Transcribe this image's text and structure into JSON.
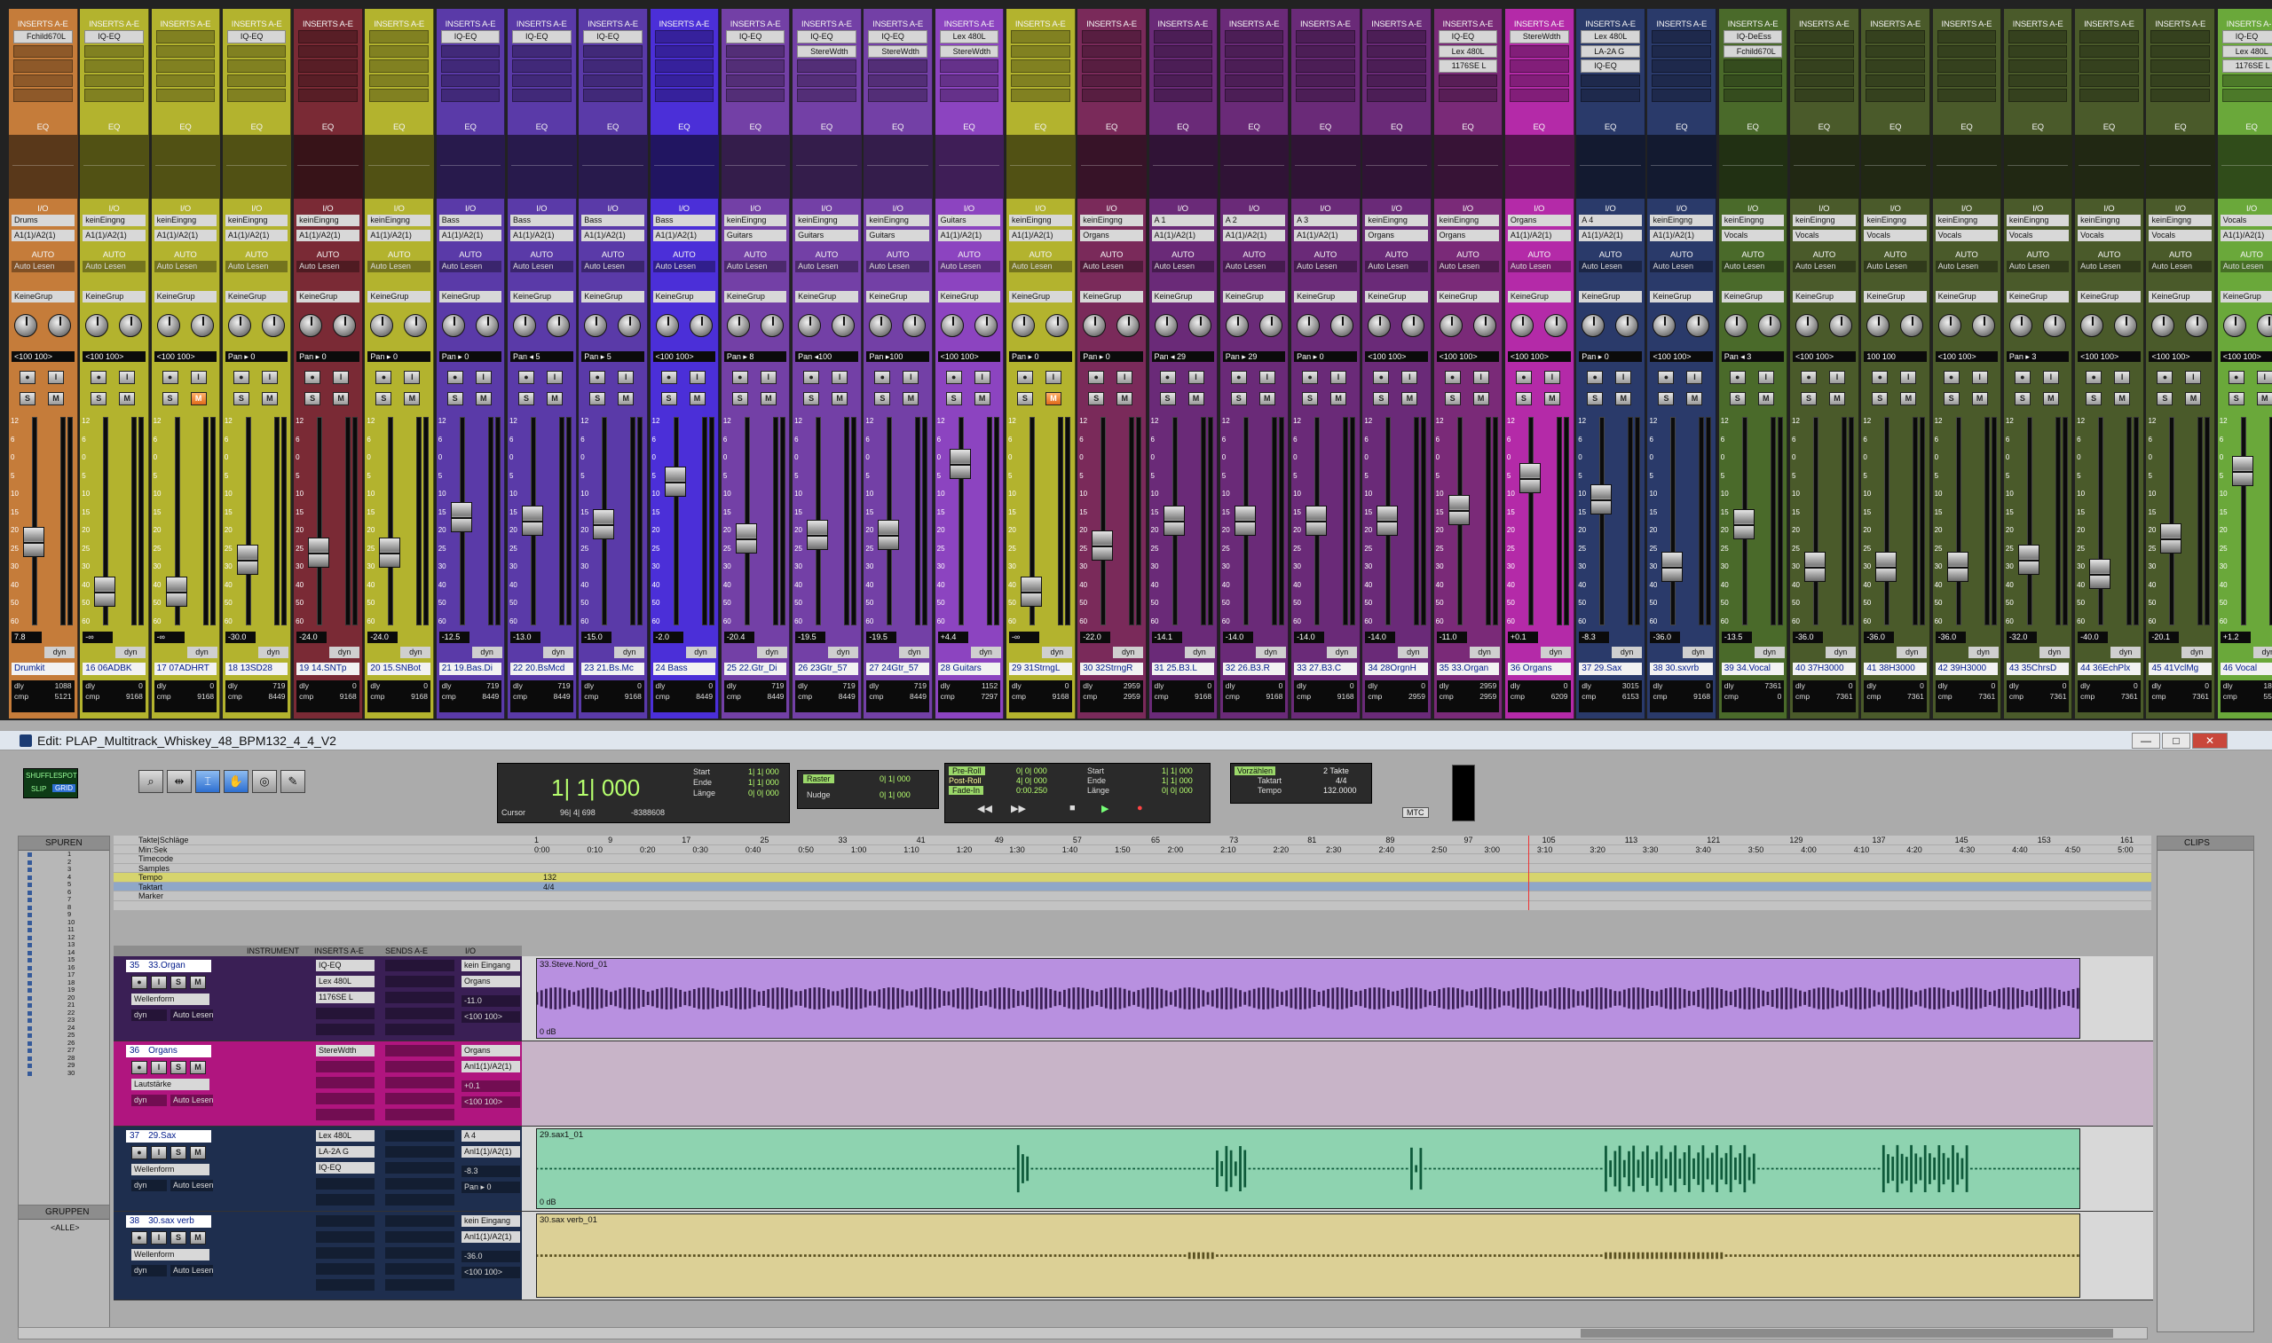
{
  "insert_header": "INSERTS A-E",
  "eq_label": "EQ",
  "io_label": "I/O",
  "auto_label": "AUTO",
  "auto_value": "Auto Lesen",
  "group_value": "KeineGrup",
  "pan_label": "Pan",
  "dyn_label": "dyn",
  "dly_label": "dly",
  "cmp_label": "cmp",
  "meter_scale": [
    "12",
    "6",
    "0",
    "5",
    "10",
    "15",
    "20",
    "25",
    "30",
    "40",
    "50",
    "60"
  ],
  "colors": {
    "accent_blue": "#2d6fd1",
    "edit_bg": "#ababab"
  },
  "mixer": {
    "tracks": [
      {
        "name": "Drumkit",
        "color": "#c57c3a",
        "inserts": [
          "Fchild670L"
        ],
        "io_in": "Drums",
        "io_out": "A1(1)/A2(1)",
        "vol": "7.8",
        "pan": "<100 100>",
        "dly": "1088",
        "cmp": "5121",
        "fader": 0.62
      },
      {
        "name": "16 06ADBK",
        "color": "#b3b32e",
        "inserts": [
          "IQ-EQ"
        ],
        "io_in": "keinEingng",
        "io_out": "A1(1)/A2(1)",
        "vol": "-∞",
        "pan": "<100 100>",
        "dly": "0",
        "cmp": "9168",
        "fader": 0.9
      },
      {
        "name": "17 07ADHRT",
        "color": "#b3b32e",
        "inserts": [],
        "io_in": "keinEingng",
        "io_out": "A1(1)/A2(1)",
        "vol": "-∞",
        "pan": "<100 100>",
        "dly": "0",
        "cmp": "9168",
        "fader": 0.9
      },
      {
        "name": "18 13SD28",
        "color": "#b3b32e",
        "inserts": [
          "IQ-EQ"
        ],
        "io_in": "keinEingng",
        "io_out": "A1(1)/A2(1)",
        "vol": "-30.0",
        "pan": "Pan ▸ 0",
        "dly": "719",
        "cmp": "8449",
        "fader": 0.72
      },
      {
        "name": "19 14.SNTp",
        "color": "#7a2a35",
        "inserts": [],
        "io_in": "keinEingng",
        "io_out": "A1(1)/A2(1)",
        "vol": "-24.0",
        "pan": "Pan ▸ 0",
        "dly": "0",
        "cmp": "9168",
        "fader": 0.68
      },
      {
        "name": "20 15.SNBot",
        "color": "#b3b32e",
        "inserts": [],
        "io_in": "keinEingng",
        "io_out": "A1(1)/A2(1)",
        "vol": "-24.0",
        "pan": "Pan ▸ 0",
        "dly": "0",
        "cmp": "9168",
        "fader": 0.68
      },
      {
        "name": "21 19.Bas.Di",
        "color": "#5a3aa8",
        "inserts": [
          "IQ-EQ"
        ],
        "io_in": "Bass",
        "io_out": "A1(1)/A2(1)",
        "vol": "-12.5",
        "pan": "Pan ▸ 0",
        "dly": "719",
        "cmp": "8449",
        "fader": 0.48
      },
      {
        "name": "22 20.BsMcd",
        "color": "#5a3aa8",
        "inserts": [
          "IQ-EQ"
        ],
        "io_in": "Bass",
        "io_out": "A1(1)/A2(1)",
        "vol": "-13.0",
        "pan": "Pan ◂ 5",
        "dly": "719",
        "cmp": "8449",
        "fader": 0.5
      },
      {
        "name": "23 21.Bs.Mc",
        "color": "#5a3aa8",
        "inserts": [
          "IQ-EQ"
        ],
        "io_in": "Bass",
        "io_out": "A1(1)/A2(1)",
        "vol": "-15.0",
        "pan": "Pan ▸ 5",
        "dly": "0",
        "cmp": "9168",
        "fader": 0.52
      },
      {
        "name": "24  Bass",
        "color": "#4b2fd8",
        "inserts": [],
        "io_in": "Bass",
        "io_out": "A1(1)/A2(1)",
        "vol": "-2.0",
        "pan": "<100 100>",
        "dly": "0",
        "cmp": "8449",
        "fader": 0.28
      },
      {
        "name": "25 22.Gtr_Di",
        "color": "#7340a6",
        "inserts": [
          "IQ-EQ"
        ],
        "io_in": "keinEingng",
        "io_out": "Guitars",
        "vol": "-20.4",
        "pan": "Pan ▸ 8",
        "dly": "719",
        "cmp": "8449",
        "fader": 0.6
      },
      {
        "name": "26 23Gtr_57",
        "color": "#7340a6",
        "inserts": [
          "IQ-EQ",
          "StereWdth"
        ],
        "io_in": "keinEingng",
        "io_out": "Guitars",
        "vol": "-19.5",
        "pan": "Pan ◂100",
        "dly": "719",
        "cmp": "8449",
        "fader": 0.58
      },
      {
        "name": "27 24Gtr_57",
        "color": "#7340a6",
        "inserts": [
          "IQ-EQ",
          "StereWdth"
        ],
        "io_in": "keinEingng",
        "io_out": "Guitars",
        "vol": "-19.5",
        "pan": "Pan ▸100",
        "dly": "719",
        "cmp": "8449",
        "fader": 0.58
      },
      {
        "name": "28  Guitars",
        "color": "#8c44c0",
        "inserts": [
          "Lex 480L",
          "StereWdth"
        ],
        "io_in": "Guitars",
        "io_out": "A1(1)/A2(1)",
        "vol": "+4.4",
        "pan": "<100 100>",
        "dly": "1152",
        "cmp": "7297",
        "fader": 0.18
      },
      {
        "name": "29 31StrngL",
        "color": "#b3b32e",
        "inserts": [],
        "io_in": "keinEingng",
        "io_out": "A1(1)/A2(1)",
        "vol": "-∞",
        "pan": "Pan ▸ 0",
        "dly": "0",
        "cmp": "9168",
        "fader": 0.9
      },
      {
        "name": "30 32StrngR",
        "color": "#7a2a5a",
        "inserts": [],
        "io_in": "keinEingng",
        "io_out": "Organs",
        "vol": "-22.0",
        "pan": "Pan ▸ 0",
        "dly": "2959",
        "cmp": "2959",
        "fader": 0.64
      },
      {
        "name": "31 25.B3.L",
        "color": "#6a2a78",
        "inserts": [],
        "io_in": "A 1",
        "io_out": "A1(1)/A2(1)",
        "vol": "-14.1",
        "pan": "Pan ◂ 29",
        "dly": "0",
        "cmp": "9168",
        "fader": 0.5
      },
      {
        "name": "32 26.B3.R",
        "color": "#6a2a78",
        "inserts": [],
        "io_in": "A 2",
        "io_out": "A1(1)/A2(1)",
        "vol": "-14.0",
        "pan": "Pan ▸ 29",
        "dly": "0",
        "cmp": "9168",
        "fader": 0.5
      },
      {
        "name": "33 27.B3.C",
        "color": "#6a2a78",
        "inserts": [],
        "io_in": "A 3",
        "io_out": "A1(1)/A2(1)",
        "vol": "-14.0",
        "pan": "Pan ▸ 0",
        "dly": "0",
        "cmp": "9168",
        "fader": 0.5
      },
      {
        "name": "34 28OrgnH",
        "color": "#6a2a78",
        "inserts": [],
        "io_in": "keinEingng",
        "io_out": "Organs",
        "vol": "-14.0",
        "pan": "<100 100>",
        "dly": "0",
        "cmp": "2959",
        "fader": 0.5
      },
      {
        "name": "35 33.Organ",
        "color": "#7a2a78",
        "inserts": [
          "IQ-EQ",
          "Lex 480L",
          "1176SE L"
        ],
        "io_in": "keinEingng",
        "io_out": "Organs",
        "vol": "-11.0",
        "pan": "<100 100>",
        "dly": "2959",
        "cmp": "2959",
        "fader": 0.44
      },
      {
        "name": "36  Organs",
        "color": "#b42aa8",
        "inserts": [
          "StereWdth"
        ],
        "io_in": "Organs",
        "io_out": "A1(1)/A2(1)",
        "vol": "+0.1",
        "pan": "<100 100>",
        "dly": "0",
        "cmp": "6209",
        "fader": 0.26
      },
      {
        "name": "37  29.Sax",
        "color": "#2a3a6a",
        "inserts": [
          "Lex 480L",
          "LA-2A G",
          "IQ-EQ"
        ],
        "io_in": "A 4",
        "io_out": "A1(1)/A2(1)",
        "vol": "-8.3",
        "pan": "Pan ▸ 0",
        "dly": "3015",
        "cmp": "6153",
        "fader": 0.38
      },
      {
        "name": "38 30.sxvrb",
        "color": "#2a3a6a",
        "inserts": [],
        "io_in": "keinEingng",
        "io_out": "A1(1)/A2(1)",
        "vol": "-36.0",
        "pan": "<100 100>",
        "dly": "0",
        "cmp": "9168",
        "fader": 0.76
      },
      {
        "name": "39 34.Vocal",
        "color": "#4a6a2a",
        "inserts": [
          "IQ-DeEss",
          "Fchild670L"
        ],
        "io_in": "keinEingng",
        "io_out": "Vocals",
        "vol": "-13.5",
        "pan": "Pan ◂ 3",
        "dly": "7361",
        "cmp": "0",
        "fader": 0.52
      },
      {
        "name": "40 37H3000",
        "color": "#4a5a2a",
        "inserts": [],
        "io_in": "keinEingng",
        "io_out": "Vocals",
        "vol": "-36.0",
        "pan": "<100 100>",
        "dly": "0",
        "cmp": "7361",
        "fader": 0.76
      },
      {
        "name": "41 38H3000",
        "color": "#4a5a2a",
        "inserts": [],
        "io_in": "keinEingng",
        "io_out": "Vocals",
        "vol": "-36.0",
        "pan": "100 100",
        "dly": "0",
        "cmp": "7361",
        "fader": 0.76
      },
      {
        "name": "42 39H3000",
        "color": "#4a5a2a",
        "inserts": [],
        "io_in": "keinEingng",
        "io_out": "Vocals",
        "vol": "-36.0",
        "pan": "<100 100>",
        "dly": "0",
        "cmp": "7361",
        "fader": 0.76
      },
      {
        "name": "43 35ChrsD",
        "color": "#4a5a2a",
        "inserts": [],
        "io_in": "keinEingng",
        "io_out": "Vocals",
        "vol": "-32.0",
        "pan": "Pan ▸ 3",
        "dly": "0",
        "cmp": "7361",
        "fader": 0.72
      },
      {
        "name": "44 36EchPlx",
        "color": "#4a5a2a",
        "inserts": [],
        "io_in": "keinEingng",
        "io_out": "Vocals",
        "vol": "-40.0",
        "pan": "<100 100>",
        "dly": "0",
        "cmp": "7361",
        "fader": 0.8
      },
      {
        "name": "45 41VclMg",
        "color": "#4a5a2a",
        "inserts": [],
        "io_in": "keinEingng",
        "io_out": "Vocals",
        "vol": "-20.1",
        "pan": "<100 100>",
        "dly": "0",
        "cmp": "7361",
        "fader": 0.6
      },
      {
        "name": "46  Vocal",
        "color": "#6aa83a",
        "inserts": [
          "IQ-EQ",
          "Lex 480L",
          "1176SE L"
        ],
        "io_in": "Vocals",
        "io_out": "A1(1)/A2(1)",
        "vol": "+1.2",
        "pan": "<100 100>",
        "dly": "1807",
        "cmp": "5554",
        "fader": 0.22
      }
    ]
  },
  "edit": {
    "title": "Edit: PLAP_Multitrack_Whiskey_48_BPM132_4_4_V2",
    "window_buttons": {
      "min": "—",
      "max": "□",
      "close": "✕"
    },
    "modes": {
      "shuffle": "SHUFFLE",
      "spot": "SPOT",
      "slip": "SLIP",
      "grid": "GRID"
    },
    "counter": {
      "main": "1| 1| 000",
      "start_label": "Start",
      "end_label": "Ende",
      "length_label": "Länge",
      "start": "1| 1| 000",
      "end": "1| 1| 000",
      "length": "0| 0| 000",
      "cursor_label": "Cursor",
      "cursor": "96| 4| 698",
      "cursor_val": "-8388608"
    },
    "grid": {
      "raster_label": "Raster",
      "raster": "0| 1| 000",
      "nudge_label": "Nudge",
      "nudge": "0| 1| 000"
    },
    "transport": {
      "preroll": "Pre-Roll",
      "postroll": "Post-Roll",
      "fadein": "Fade-In",
      "pre_val": "0| 0| 000",
      "post_val": "4| 0| 000",
      "fade_val": "0:00.250",
      "start_label": "Start",
      "end_label": "Ende",
      "length_label": "Länge",
      "start": "1| 1| 000",
      "end": "1| 1| 000",
      "length": "0| 0| 000"
    },
    "count": {
      "label": "Vorzählen",
      "bars": "2 Takte",
      "meter_label": "Taktart",
      "meter": "4/4",
      "tempo_label": "Tempo",
      "tempo": "132.0000"
    },
    "mtc": "MTC",
    "tracks_title": "SPUREN",
    "groups_title": "GRUPPEN",
    "groups_all": "<ALLE>",
    "clips_title": "CLIPS",
    "ruler_rows": [
      "Takte|Schläge",
      "Min:Sek",
      "Timecode",
      "Samples",
      "Tempo",
      "Taktart",
      "Marker"
    ],
    "bars": [
      "1",
      "9",
      "17",
      "25",
      "33",
      "41",
      "49",
      "57",
      "65",
      "73",
      "81",
      "89",
      "97",
      "105",
      "113",
      "121",
      "129",
      "137",
      "145",
      "153",
      "161"
    ],
    "minsec": [
      "0:00",
      "0:10",
      "0:20",
      "0:30",
      "0:40",
      "0:50",
      "1:00",
      "1:10",
      "1:20",
      "1:30",
      "1:40",
      "1:50",
      "2:00",
      "2:10",
      "2:20",
      "2:30",
      "2:40",
      "2:50",
      "3:00",
      "3:10",
      "3:20",
      "3:30",
      "3:40",
      "3:50",
      "4:00",
      "4:10",
      "4:20",
      "4:30",
      "4:40",
      "4:50",
      "5:00"
    ],
    "tempo_val": "132",
    "meter_val": "4/4",
    "track_list": [
      "1",
      "2",
      "3",
      "4",
      "5",
      "6",
      "7",
      "8",
      "9",
      "10",
      "11",
      "12",
      "13",
      "14",
      "15",
      "16",
      "17",
      "18",
      "19",
      "20",
      "21",
      "22",
      "23",
      "24",
      "25",
      "26",
      "27",
      "28",
      "29",
      "30"
    ],
    "col_headers": {
      "instrument": "INSTRUMENT",
      "inserts": "INSERTS A-E",
      "sends": "SENDS A-E",
      "io": "I/O"
    },
    "edit_tracks": [
      {
        "name": "33.Organ",
        "num": "35",
        "inserts": [
          "IQ-EQ",
          "Lex 480L",
          "1176SE L"
        ],
        "io_in": "kein Eingang",
        "io_out": "Organs",
        "view": "Wellenform",
        "vol": "-11.0",
        "pan": "<100 100>",
        "clip": "33.Steve.Nord_01",
        "color": "#b890e0",
        "hd": "#3a1f55",
        "gain": "0 dB"
      },
      {
        "name": "Organs",
        "num": "36",
        "inserts": [
          "StereWdth"
        ],
        "io_in": "Organs",
        "io_out": "Anl1(1)/A2(1)",
        "view": "Lautstärke",
        "vol": "+0.1",
        "pan": "<100 100>",
        "clip": "",
        "color": "#c0a0c8",
        "hd": "#b0157f",
        "gain": ""
      },
      {
        "name": "29.Sax",
        "num": "37",
        "inserts": [
          "Lex 480L",
          "LA-2A G",
          "IQ-EQ"
        ],
        "io_in": "A 4",
        "io_out": "Anl1(1)/A2(1)",
        "view": "Wellenform",
        "vol": "-8.3",
        "pan": "Pan ▸ 0",
        "clip": "29.sax1_01",
        "color": "#8ed3b0",
        "hd": "#1e2e4e",
        "gain": "0 dB"
      },
      {
        "name": "30.sax verb",
        "num": "38",
        "inserts": [],
        "io_in": "kein Eingang",
        "io_out": "Anl1(1)/A2(1)",
        "view": "Wellenform",
        "vol": "-36.0",
        "pan": "<100 100>",
        "clip": "30.sax verb_01",
        "color": "#dcd096",
        "hd": "#1e2e4e",
        "gain": ""
      }
    ]
  }
}
